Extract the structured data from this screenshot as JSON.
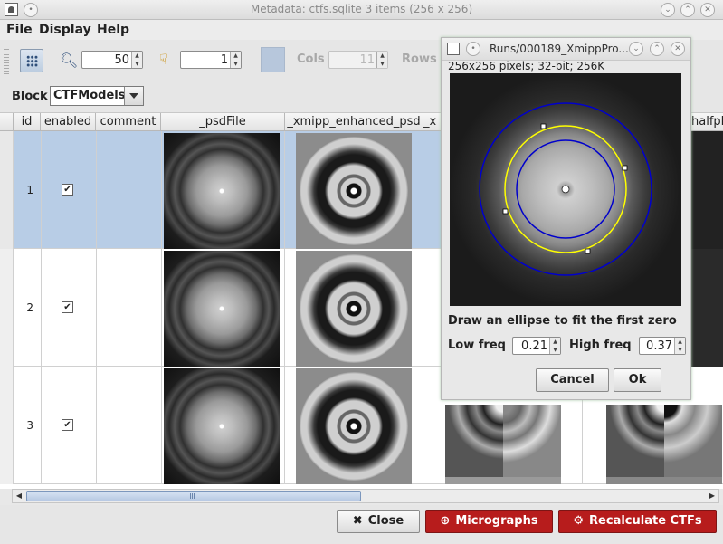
{
  "window": {
    "title": "Metadata: ctfs.sqlite 3 items (256 x 256)"
  },
  "menu": {
    "items": [
      "File",
      "Display",
      "Help"
    ]
  },
  "toolbar": {
    "zoom_value": "50",
    "goto_value": "1",
    "cols_label": "Cols",
    "cols_value": "11",
    "rows_label": "Rows"
  },
  "block": {
    "label": "Block",
    "selected": "CTFModels"
  },
  "table": {
    "columns": [
      "id",
      "enabled",
      "comment",
      "_psdFile",
      "_xmipp_enhanced_psd",
      "_x",
      "halfpl"
    ],
    "rows": [
      {
        "num": "1",
        "id": "1",
        "enabled": true,
        "selected": true
      },
      {
        "num": "2",
        "id": "2",
        "enabled": true,
        "selected": false
      },
      {
        "num": "3",
        "id": "3",
        "enabled": true,
        "selected": false
      }
    ]
  },
  "buttons": {
    "close": "Close",
    "micrographs": "Micrographs",
    "recalculate": "Recalculate CTFs"
  },
  "dialog": {
    "title": "Runs/000189_XmippPro...",
    "info": "256x256 pixels; 32-bit; 256K",
    "prompt": "Draw an ellipse to fit the first zero",
    "low_label": "Low freq",
    "low_value": "0.21",
    "high_label": "High freq",
    "high_value": "0.37",
    "cancel": "Cancel",
    "ok": "Ok"
  },
  "colors": {
    "selection": "#b8cde6",
    "accent_red": "#b71c1c",
    "ellipse_yellow": "#ffff00",
    "ring_blue": "#0000cc"
  }
}
